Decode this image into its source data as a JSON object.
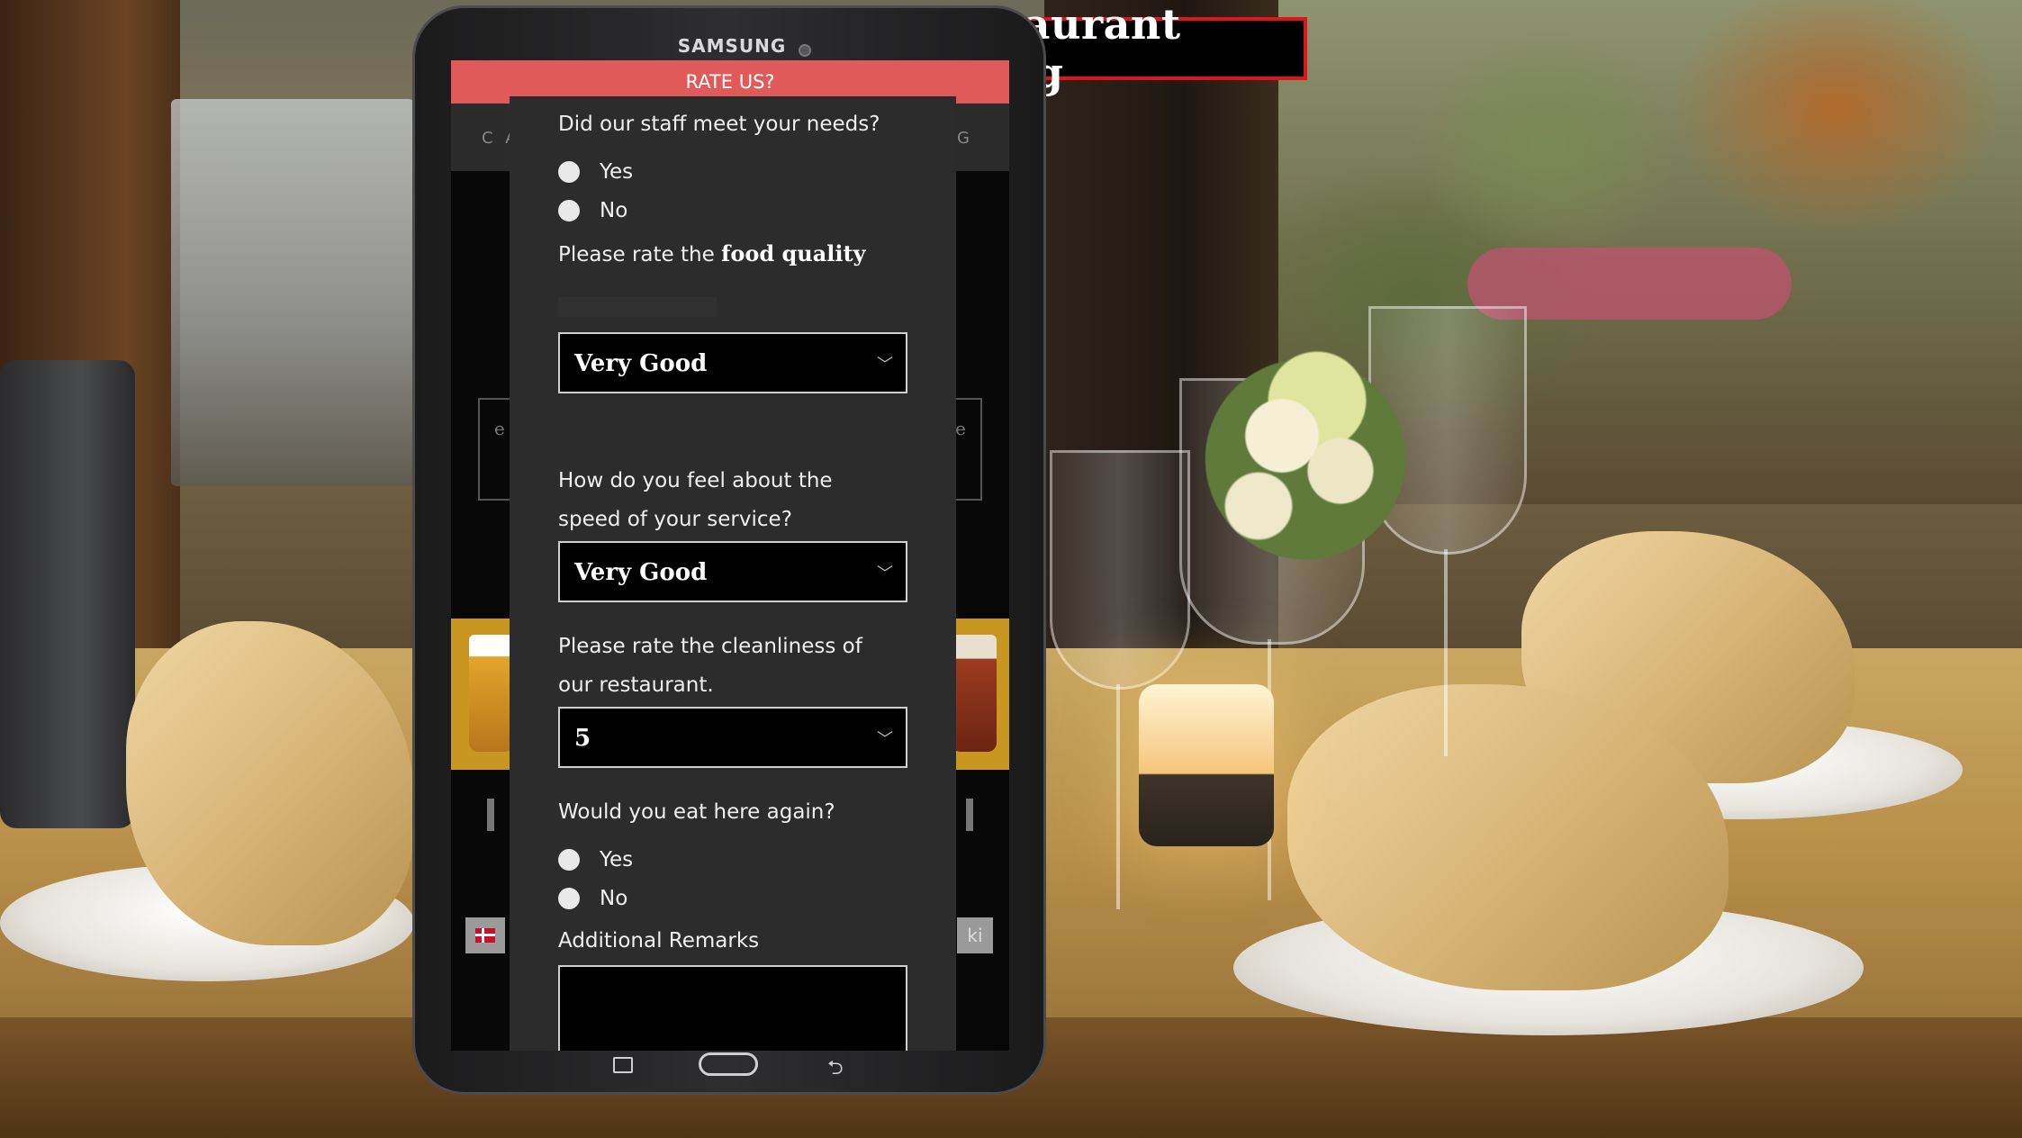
{
  "overlay": {
    "title": "Restaurant rating"
  },
  "device": {
    "brand": "SAMSUNG"
  },
  "app": {
    "header": "RATE US?",
    "nav_left": "C A",
    "nav_right": "G",
    "bg_left": "e",
    "bg_right": "e",
    "ki_label": "ki"
  },
  "survey": {
    "q1": "Did our staff meet your needs?",
    "q1_options": [
      "Yes",
      "No"
    ],
    "q2_prefix": "Please rate the",
    "q2_emphasis": "food quality",
    "q2_value": "Very Good",
    "q3_line1": "How do you feel about the",
    "q3_line2": "speed of your service?",
    "q3_value": "Very Good",
    "q4_line1": "Please rate the cleanliness of",
    "q4_line2": "our restaurant.",
    "q4_value": "5",
    "q5": "Would you eat here again?",
    "q5_options": [
      "Yes",
      "No"
    ],
    "remarks_label": "Additional Remarks",
    "remarks_value": ""
  },
  "icons": {
    "chevron": "chevron-down-icon",
    "back": "back-arrow-icon"
  },
  "colors": {
    "header": "#e05a5a",
    "modal_bg": "#2c2c2d",
    "title_border": "#e0141b"
  }
}
